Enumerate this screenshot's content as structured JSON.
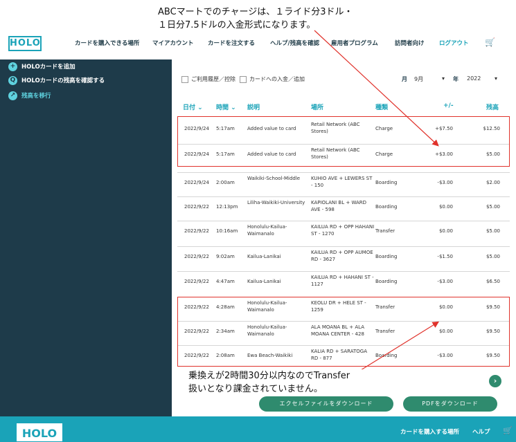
{
  "annotations": {
    "top_line1": "ABCマートでのチャージは、１ライド分3ドル・",
    "top_line2": "１日分7.5ドルの入金形式になります。",
    "bottom_line1": "乗換えが2時間30分以内なのでTransfer",
    "bottom_line2": "扱いとなり課金されていません。",
    "highlight_color": "#e0322b"
  },
  "header": {
    "logo": "HOLO",
    "nav": [
      "カードを購入できる場所",
      "マイアカウント",
      "カードを注文する",
      "ヘルプ/残高を確認",
      "雇用者プログラム",
      "訪問者向け",
      "ログアウト"
    ],
    "cart_icon": "cart-icon"
  },
  "sidebar": {
    "items": [
      {
        "icon": "+",
        "label": "HOLOカードを追加"
      },
      {
        "icon": "Q",
        "label": "HOLOカードの残高を確認する"
      },
      {
        "icon": "↗",
        "label": "残高を移行"
      }
    ]
  },
  "filters": {
    "history_label": "ご利用履歴／控除",
    "topup_label": "カードへの入金／追加",
    "month_label": "月",
    "month_value": "9月",
    "year_label": "年",
    "year_value": "2022"
  },
  "table": {
    "headers": [
      "日付",
      "時間",
      "説明",
      "場所",
      "種類",
      "+/-",
      "残高"
    ],
    "rows": [
      {
        "date": "2022/9/24",
        "time": "5:17am",
        "desc": "Added value to card",
        "place": "Retail Network (ABC Stores)",
        "type": "Charge",
        "amount": "+$7.50",
        "balance": "$12.50"
      },
      {
        "date": "2022/9/24",
        "time": "5:17am",
        "desc": "Added value to card",
        "place": "Retail Network (ABC Stores)",
        "type": "Charge",
        "amount": "+$3.00",
        "balance": "$5.00"
      },
      {
        "date": "2022/9/24",
        "time": "2:00am",
        "desc": "Waikiki-School-Middle",
        "place": "KUHIO AVE + LEWERS ST - 150",
        "type": "Boarding",
        "amount": "-$3.00",
        "balance": "$2.00"
      },
      {
        "date": "2022/9/22",
        "time": "12:13pm",
        "desc": "Liliha-Waikiki-University",
        "place": "KAPIOLANI BL + WARD AVE - 598",
        "type": "Boarding",
        "amount": "$0.00",
        "balance": "$5.00"
      },
      {
        "date": "2022/9/22",
        "time": "10:16am",
        "desc": "Honolulu-Kailua-Waimanalo",
        "place": "KAILUA RD + OPP HAHANI ST - 1270",
        "type": "Transfer",
        "amount": "$0.00",
        "balance": "$5.00"
      },
      {
        "date": "2022/9/22",
        "time": "9:02am",
        "desc": "Kailua-Lanikai",
        "place": "KAILUA RD + OPP AUMOE RD - 3627",
        "type": "Boarding",
        "amount": "-$1.50",
        "balance": "$5.00"
      },
      {
        "date": "2022/9/22",
        "time": "4:47am",
        "desc": "Kailua-Lanikai",
        "place": "KAILUA RD + HAHANI ST - 1127",
        "type": "Boarding",
        "amount": "-$3.00",
        "balance": "$6.50"
      },
      {
        "date": "2022/9/22",
        "time": "4:28am",
        "desc": "Honolulu-Kailua-Waimanalo",
        "place": "KEOLU DR + HELE ST - 1259",
        "type": "Transfer",
        "amount": "$0.00",
        "balance": "$9.50"
      },
      {
        "date": "2022/9/22",
        "time": "2:34am",
        "desc": "Honolulu-Kailua-Waimanalo",
        "place": "ALA MOANA BL + ALA MOANA CENTER - 428",
        "type": "Transfer",
        "amount": "$0.00",
        "balance": "$9.50"
      },
      {
        "date": "2022/9/22",
        "time": "2:08am",
        "desc": "Ewa Beach-Waikiki",
        "place": "KALIA RD + SARATOGA RD - 877",
        "type": "Boarding",
        "amount": "-$3.00",
        "balance": "$9.50"
      }
    ]
  },
  "actions": {
    "next": "›",
    "excel": "エクセルファイルをダウンロード",
    "pdf": "PDFをダウンロード"
  },
  "footer": {
    "logo": "HOLO",
    "links": [
      "カードを購入する場所",
      "ヘルプ"
    ]
  },
  "colors": {
    "sidebar": "#1e3b4a",
    "accent": "#1aa3b8",
    "button": "#2f8b6e",
    "annotation": "#e0322b"
  }
}
